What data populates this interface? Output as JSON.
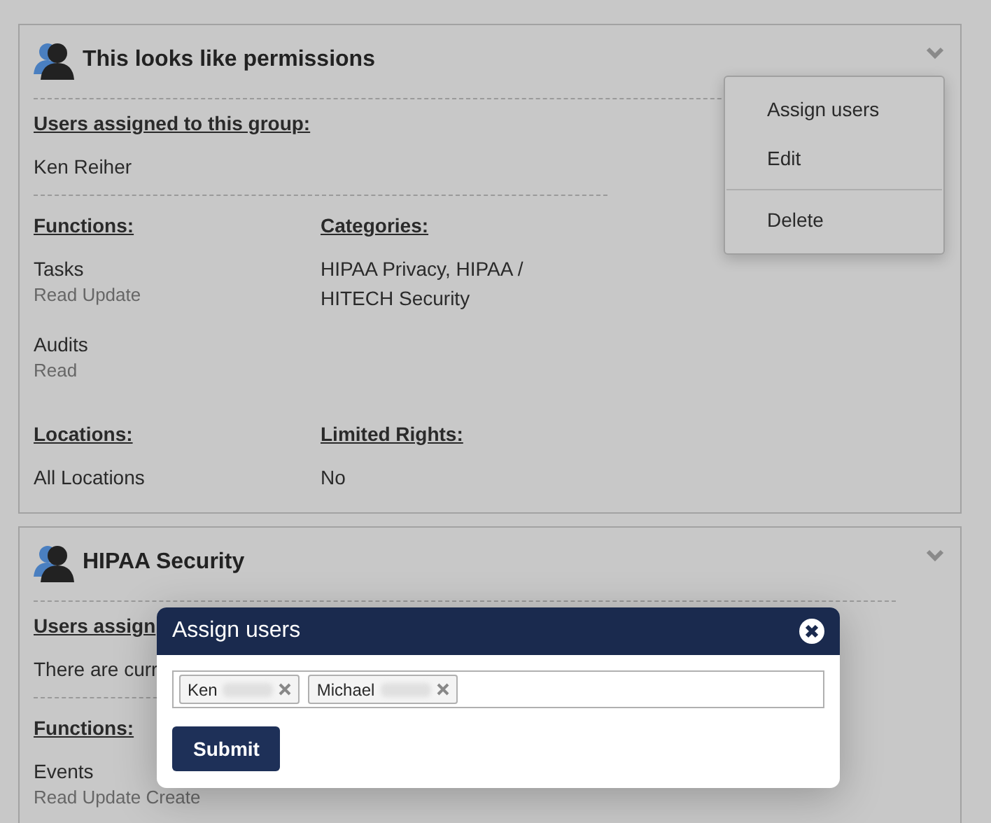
{
  "groups": [
    {
      "title": "This looks like permissions",
      "users_label": "Users assigned to this group:",
      "users": "Ken Reiher",
      "functions_label": "Functions:",
      "functions": [
        {
          "name": "Tasks",
          "permissions": "Read Update"
        },
        {
          "name": "Audits",
          "permissions": "Read"
        }
      ],
      "categories_label": "Categories:",
      "categories": "HIPAA Privacy, HIPAA / HITECH Security",
      "locations_label": "Locations:",
      "locations": "All Locations",
      "limited_rights_label": "Limited Rights:",
      "limited_rights": "No"
    },
    {
      "title": "HIPAA Security",
      "users_label": "Users assign",
      "users": "There are curr",
      "functions_label": "Functions:",
      "functions": [
        {
          "name": "Events",
          "permissions": "Read Update Create"
        }
      ]
    }
  ],
  "menu": [
    [
      {
        "label": "Assign users"
      },
      {
        "label": "Edit"
      }
    ],
    [
      {
        "label": "Delete"
      }
    ]
  ],
  "dialog": {
    "title": "Assign users",
    "chips": [
      {
        "label": "Ken"
      },
      {
        "label": "Michael"
      }
    ],
    "submit": "Submit"
  }
}
